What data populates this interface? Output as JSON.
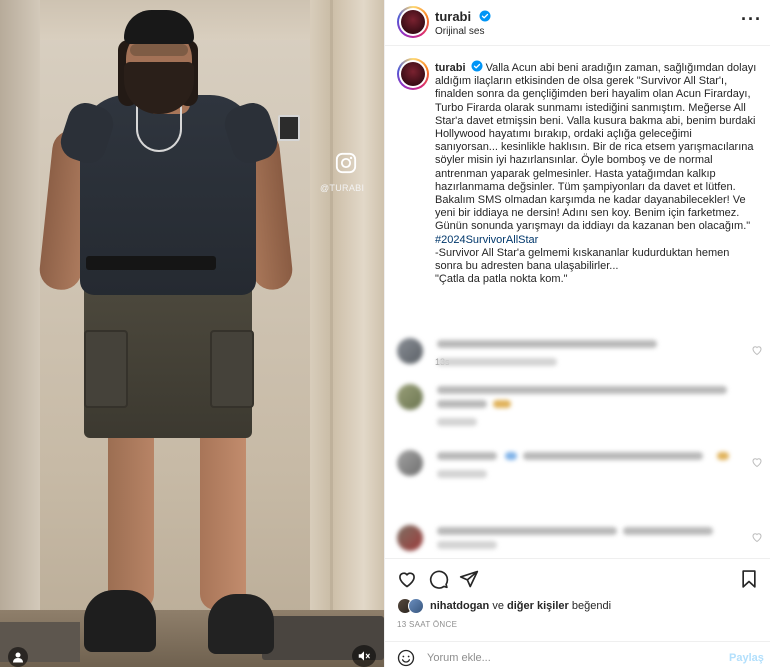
{
  "post": {
    "username": "turabi",
    "audio": "Orijinal ses",
    "more_icon": "more-horizontal-icon",
    "verified_color": "#0095f6"
  },
  "media": {
    "watermark": "@TURABI"
  },
  "caption": {
    "username": "turabi",
    "lines": [
      "Valla Acun abi beni aradığın zaman, sağlığımdan dolayı",
      "aldığım ilaçların etkisinden de olsa gerek \"Survivor All Star'ı,",
      "finalden sonra da gençliğimden beri hayalim olan Acun Firardayı,",
      "Turbo Firarda olarak sunmamı istediğini sanmıştım. Meğerse All",
      "Star'a davet etmişsin beni. Valla kusura bakma abi, benim burdaki",
      "Hollywood hayatımı bırakıp, ordaki açlığa geleceğimi",
      "sanıyorsan... kesinlikle haklısın. Bir de rica etsem yarışmacılarına",
      "söyler misin iyi hazırlansınlar. Öyle bomboş ve de normal",
      "antrenman yaparak gelmesinler. Hasta yatağımdan kalkıp",
      "hazırlanmama değsinler. Tüm şampiyonları da davet et lütfen.",
      "Bakalım SMS olmadan karşımda ne kadar dayanabilecekler! Ve",
      "yeni bir iddiaya ne dersin! Adını sen koy. Benim için farketmez.",
      "Günün sonunda yarışmayı da iddiayı da kazanan ben olacağım.\""
    ],
    "hashtag": "#2024SurvivorAllStar",
    "after_lines": [
      "-Survivor All Star'a gelmemi kıskananlar kudurduktan hemen",
      "sonra bu adresten bana ulaşabilirler...",
      "\"Çatla da patla nokta kom.\""
    ],
    "time": "13s"
  },
  "likes": {
    "first_liker": "nihatdogan",
    "connector": "ve",
    "others": "diğer kişiler",
    "suffix": "beğendi"
  },
  "date": "13 SAAT ÖNCE",
  "comment_box": {
    "placeholder": "Yorum ekle...",
    "share_label": "Paylaş"
  },
  "icons": {
    "like": "heart-icon",
    "comment": "comment-icon",
    "share": "send-icon",
    "save": "bookmark-icon",
    "emoji": "emoji-icon"
  },
  "colors": {
    "link": "#00376b",
    "share_disabled": "#b2dffc",
    "muted": "#8e8e8e"
  }
}
